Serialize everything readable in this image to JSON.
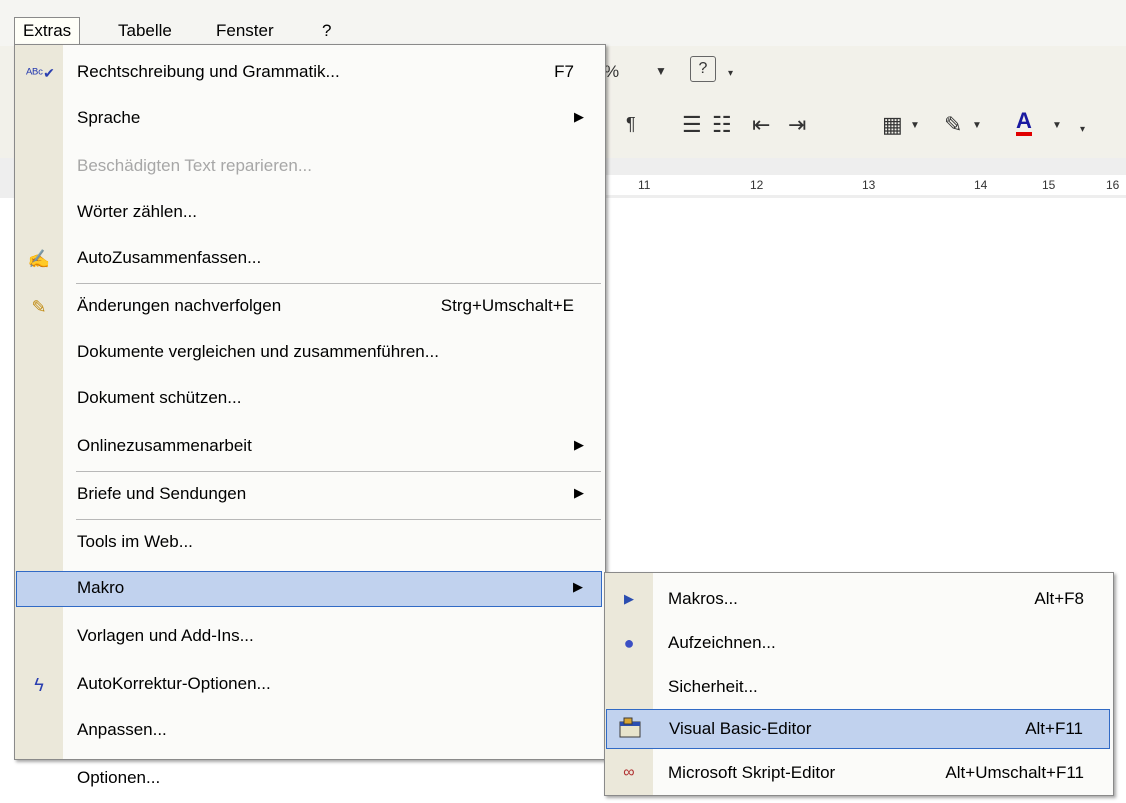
{
  "menubar": {
    "items": [
      {
        "label": "Extras",
        "active": true
      },
      {
        "label": "Tabelle"
      },
      {
        "label": "Fenster"
      },
      {
        "label": "?"
      }
    ]
  },
  "ruler": {
    "ticks": [
      "11",
      "12",
      "13",
      "14",
      "15",
      "16"
    ]
  },
  "toolbar": {
    "zoom_suffix": "%",
    "help_icon": "help-icon",
    "pilcrow_icon": "pilcrow-icon",
    "numbering_icon": "numbering-icon",
    "bullets_icon": "bullets-icon",
    "outdent_icon": "outdent-icon",
    "indent_icon": "indent-icon",
    "border_icon": "border-icon",
    "highlight_icon": "highlight-icon",
    "font_color_icon": "font-color-icon",
    "font_color_accent": "#e00000"
  },
  "menu": {
    "items": [
      {
        "label": "Rechtschreibung und Grammatik...",
        "shortcut": "F7",
        "icon": "spellcheck-icon"
      },
      {
        "label": "Sprache",
        "submenu": true
      },
      {
        "label": "Beschädigten Text reparieren...",
        "disabled": true
      },
      {
        "label": "Wörter zählen..."
      },
      {
        "label": "AutoZusammenfassen...",
        "icon": "autosummarize-icon"
      },
      {
        "label": "Änderungen nachverfolgen",
        "shortcut": "Strg+Umschalt+E",
        "icon": "track-changes-icon"
      },
      {
        "label": "Dokumente vergleichen und zusammenführen..."
      },
      {
        "label": "Dokument schützen..."
      },
      {
        "label": "Onlinezusammenarbeit",
        "submenu": true
      },
      {
        "label": "Briefe und Sendungen",
        "submenu": true
      },
      {
        "label": "Tools im Web..."
      },
      {
        "label": "Makro",
        "submenu": true,
        "highlight": true
      },
      {
        "label": "Vorlagen und Add-Ins..."
      },
      {
        "label": "AutoKorrektur-Optionen...",
        "icon": "autocorrect-icon"
      },
      {
        "label": "Anpassen..."
      },
      {
        "label": "Optionen..."
      }
    ]
  },
  "submenu": {
    "items": [
      {
        "label": "Makros...",
        "shortcut": "Alt+F8",
        "icon": "play-icon"
      },
      {
        "label": "Aufzeichnen...",
        "icon": "record-icon"
      },
      {
        "label": "Sicherheit..."
      },
      {
        "label": "Visual Basic-Editor",
        "shortcut": "Alt+F11",
        "icon": "vb-editor-icon",
        "highlight": true
      },
      {
        "label": "Microsoft Skript-Editor",
        "shortcut": "Alt+Umschalt+F11",
        "icon": "script-editor-icon"
      }
    ]
  },
  "colors": {
    "highlight_bg": "#c1d2ee",
    "highlight_border": "#316ac5",
    "icon_column": "#ebe8da",
    "record_dot": "#3b4fc4",
    "play_arrow": "#2a4db0"
  }
}
